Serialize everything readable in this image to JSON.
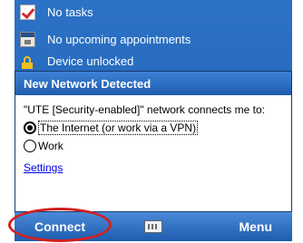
{
  "today": {
    "items": [
      {
        "icon": "tasks-icon",
        "label": "No tasks"
      },
      {
        "icon": "calendar-icon",
        "label": "No upcoming appointments"
      },
      {
        "icon": "lock-icon",
        "label": "Device unlocked"
      }
    ]
  },
  "notification": {
    "title": "New Network Detected",
    "message": "\"UTE [Security-enabled]\" network connects me to:",
    "options": [
      {
        "label": "The Internet (or work via a VPN)",
        "selected": true
      },
      {
        "label": "Work",
        "selected": false
      }
    ],
    "settings_link": "Settings"
  },
  "menubar": {
    "left_softkey": "Connect",
    "right_softkey": "Menu",
    "center_icon": "keyboard-icon"
  },
  "colors": {
    "title_bar": "#1e5cae",
    "background": "#2c72c6",
    "highlight": "#d41f1f",
    "link": "#0000ee"
  }
}
